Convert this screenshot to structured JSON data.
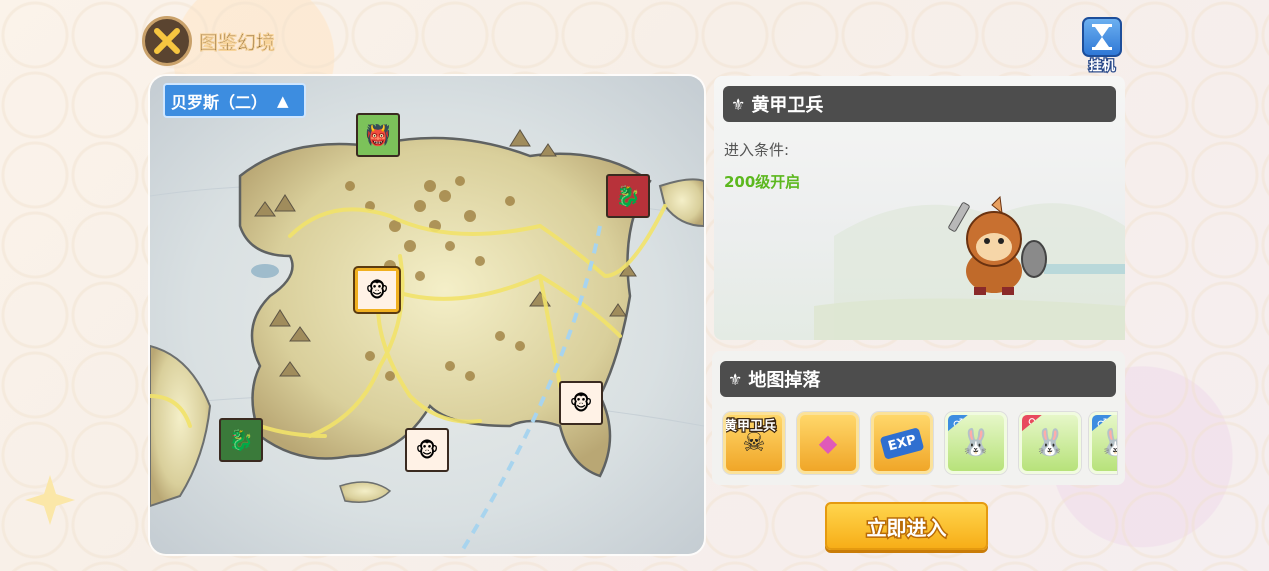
{
  "header": {
    "title": "图鉴幻境",
    "idle_label": "挂机"
  },
  "map": {
    "region_label": "贝罗斯（二）",
    "region_toggle": "▲",
    "nodes": [
      {
        "name": "green-orc",
        "bg": "#7cc25a",
        "glyph": "👹"
      },
      {
        "name": "dark-dragon-red",
        "bg": "#b8323a",
        "glyph": "🐉"
      },
      {
        "name": "monkey-selected",
        "bg": "#fff2e6",
        "glyph": "🐵"
      },
      {
        "name": "monkey-east",
        "bg": "#fff2e6",
        "glyph": "🐵"
      },
      {
        "name": "green-dragon",
        "bg": "#3a7a3a",
        "glyph": "🐉"
      },
      {
        "name": "monkey-south",
        "bg": "#fff2e6",
        "glyph": "🐵"
      }
    ]
  },
  "boss": {
    "title": "黄甲卫兵",
    "condition_label": "进入条件:",
    "condition_value": "200级开启"
  },
  "drops": {
    "title": "地图掉落",
    "items": [
      {
        "caption": "黄甲卫兵",
        "style": "gold",
        "icon": "☠"
      },
      {
        "caption": "",
        "style": "gold",
        "icon": "◆"
      },
      {
        "caption": "",
        "style": "gold",
        "icon": "EXP"
      },
      {
        "caption": "",
        "style": "green",
        "icon": "🐰",
        "gender": "♂"
      },
      {
        "caption": "",
        "style": "green",
        "icon": "🐰",
        "gender": "♀"
      },
      {
        "caption": "",
        "style": "green",
        "icon": "🐰",
        "gender": "♂"
      }
    ]
  },
  "actions": {
    "enter_label": "立即进入"
  },
  "colors": {
    "accent_blue": "#3d8de0",
    "condition_green": "#5cb81e",
    "button_gold": "#f7ae18",
    "header_dark": "#4d4d4d"
  }
}
